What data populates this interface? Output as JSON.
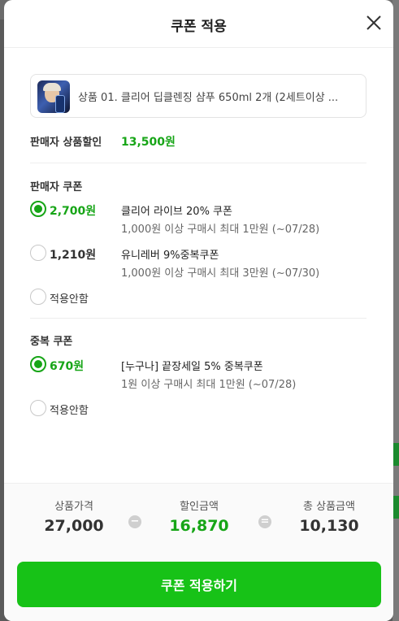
{
  "modal": {
    "title": "쿠폰 적용"
  },
  "product": {
    "name": "상품 01. 클리어 딥클렌징 샴푸 650ml 2개 (2세트이상 ..."
  },
  "seller_discount": {
    "label": "판매자 상품할인",
    "value": "13,500원"
  },
  "seller_coupons": {
    "title": "판매자 쿠폰",
    "options": [
      {
        "amount": "2,700원",
        "name": "클리어 라이브 20% 쿠폰",
        "desc": "1,000원 이상 구매시 최대 1만원 (~07/28)",
        "selected": true
      },
      {
        "amount": "1,210원",
        "name": "유니레버 9%중복쿠폰",
        "desc": "1,000원 이상 구매시 최대 3만원 (~07/30)",
        "selected": false
      }
    ],
    "none_label": "적용안함"
  },
  "dup_coupons": {
    "title": "중복 쿠폰",
    "options": [
      {
        "amount": "670원",
        "name": "[누구나] 끝장세일 5% 중복쿠폰",
        "desc": "1원 이상 구매시 최대 1만원 (~07/28)",
        "selected": true
      }
    ],
    "none_label": "적용안함"
  },
  "summary": {
    "price_label": "상품가격",
    "price_value": "27,000",
    "discount_label": "할인금액",
    "discount_value": "16,870",
    "total_label": "총 상품금액",
    "total_value": "10,130",
    "minus_symbol": "−",
    "equals_symbol": "="
  },
  "apply_button": "쿠폰 적용하기",
  "colors": {
    "accent": "#17a517",
    "button": "#17c217"
  },
  "icons": {
    "close": "close-icon"
  }
}
